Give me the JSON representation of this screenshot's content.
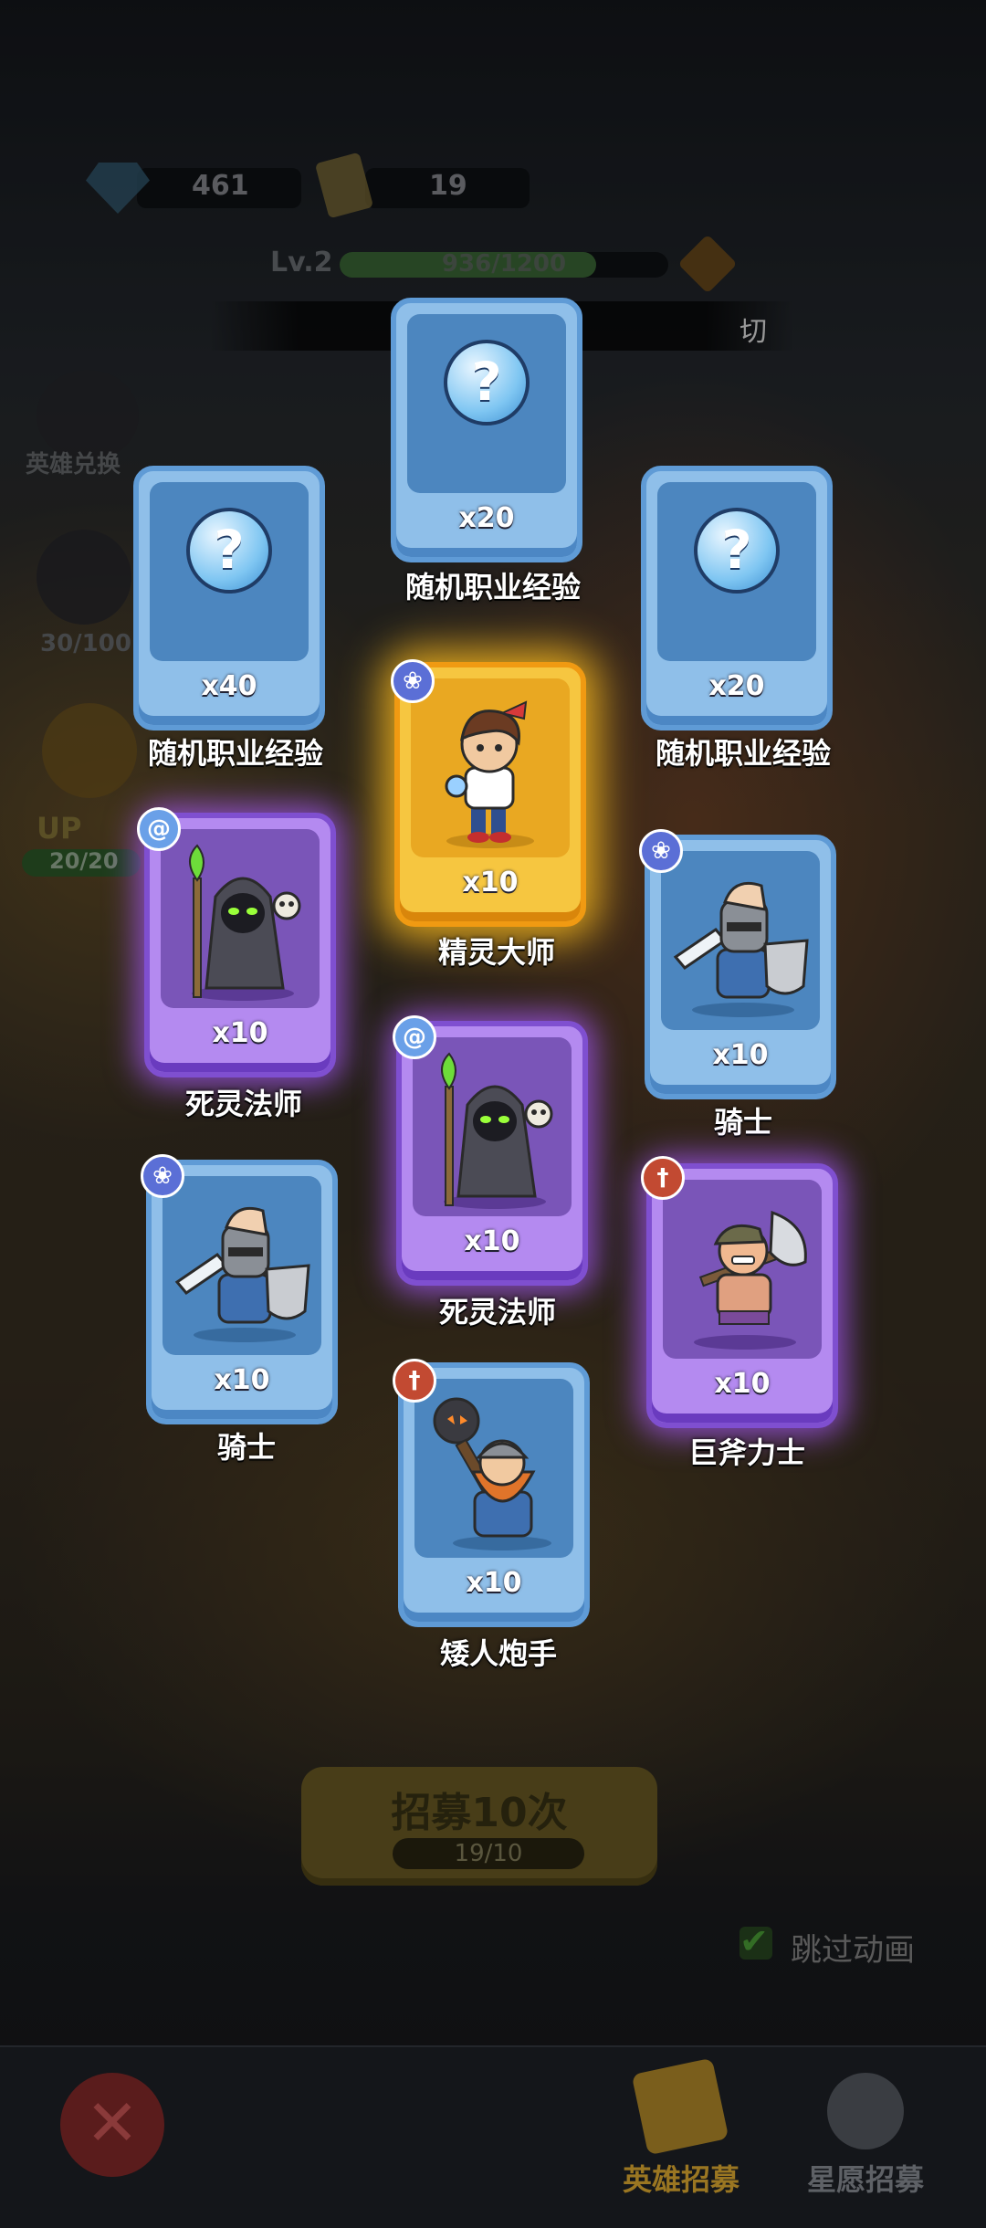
{
  "resources": {
    "gems": "461",
    "tickets": "19"
  },
  "player": {
    "level_label": "Lv.2",
    "xp_text": "936/1200",
    "xp_fraction": 0.78
  },
  "banner": {
    "skip_label": "切"
  },
  "side_menu": {
    "hero_exchange_label": "英雄兑换",
    "progress_label": "30/100",
    "up_label": "UP",
    "up_count": "20/20"
  },
  "cards": [
    {
      "name": "随机职业经验",
      "qty": "x20",
      "rarity": "blue",
      "icon": "question-bubble-icon"
    },
    {
      "name": "随机职业经验",
      "qty": "x40",
      "rarity": "blue",
      "icon": "question-bubble-icon"
    },
    {
      "name": "随机职业经验",
      "qty": "x20",
      "rarity": "blue",
      "icon": "question-bubble-icon"
    },
    {
      "name": "精灵大师",
      "qty": "x10",
      "rarity": "gold",
      "badge": "paw-icon"
    },
    {
      "name": "死灵法师",
      "qty": "x10",
      "rarity": "purple",
      "badge": "swirl-icon"
    },
    {
      "name": "骑士",
      "qty": "x10",
      "rarity": "blue",
      "badge": "paw-icon"
    },
    {
      "name": "死灵法师",
      "qty": "x10",
      "rarity": "purple",
      "badge": "swirl-icon"
    },
    {
      "name": "骑士",
      "qty": "x10",
      "rarity": "blue",
      "badge": "paw-icon"
    },
    {
      "name": "巨斧力士",
      "qty": "x10",
      "rarity": "purple",
      "badge": "sword-icon"
    },
    {
      "name": "矮人炮手",
      "qty": "x10",
      "rarity": "blue",
      "badge": "sword-icon"
    }
  ],
  "recruit": {
    "button_label": "招募10次",
    "count": "19/10",
    "skip_animation_label": "跳过动画",
    "skip_animation_checked": true
  },
  "bottom_tabs": {
    "close_icon": "close-icon",
    "hero_recruit_label": "英雄招募",
    "star_wish_label": "星愿招募"
  },
  "colors": {
    "blue_card": "#8fbfe9",
    "purple_card": "#b48af0",
    "gold_card": "#f6c640",
    "hero_tab_label": "#b88a1a"
  }
}
